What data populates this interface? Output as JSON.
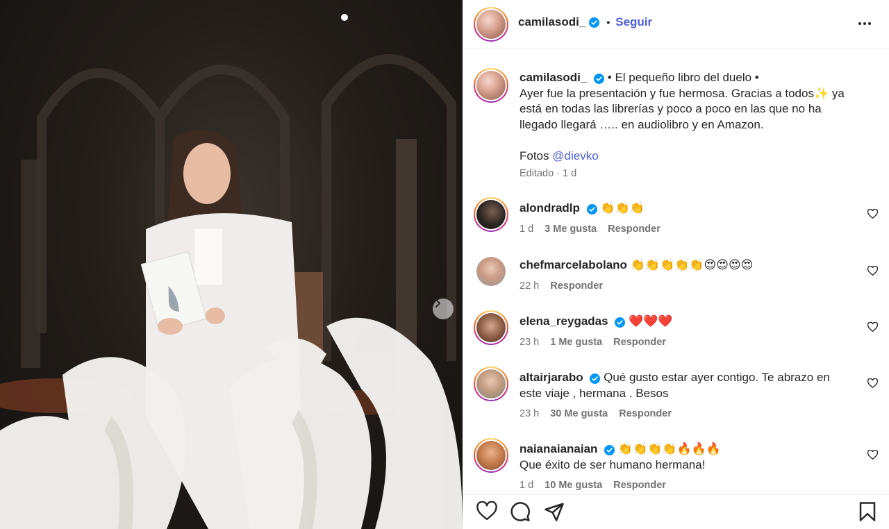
{
  "post": {
    "username": "camilasodi_",
    "follow_label": "Seguir",
    "caption_title": "• El pequeño libro del duelo •",
    "caption_body": "Ayer fue la presentación y fue hermosa. Gracias a todos✨ ya está en todas las librerías y poco a poco en las que no ha llegado llegará ….. en audiolibro y en Amazon.",
    "photos_label": "Fotos",
    "photos_handle": "@dievko",
    "edited": "Editado · 1 d"
  },
  "comments": [
    {
      "user": "alondradlp",
      "verified": true,
      "text": "👏👏👏",
      "time": "1 d",
      "likes": "3 Me gusta",
      "reply": "Responder"
    },
    {
      "user": "chefmarcelabolano",
      "verified": false,
      "text": "👏👏👏👏👏😍😍😍😍",
      "time": "22 h",
      "likes": "",
      "reply": "Responder"
    },
    {
      "user": "elena_reygadas",
      "verified": true,
      "text": "❤️❤️❤️",
      "time": "23 h",
      "likes": "1 Me gusta",
      "reply": "Responder"
    },
    {
      "user": "altairjarabo",
      "verified": true,
      "text": "Qué gusto estar ayer contigo. Te abrazo en este viaje , hermana . Besos",
      "time": "23 h",
      "likes": "30 Me gusta",
      "reply": "Responder"
    },
    {
      "user": "naianaianaian",
      "verified": true,
      "text": "👏👏👏👏🔥🔥🔥",
      "text2": "Que éxito de ser humano hermana!",
      "time": "1 d",
      "likes": "10 Me gusta",
      "reply": "Responder"
    }
  ],
  "icons": {
    "verified": "verified-badge-icon",
    "more": "more-options-icon",
    "next": "chevron-right-icon",
    "like": "heart-icon",
    "comment": "comment-bubble-icon",
    "share": "paper-plane-icon",
    "save": "bookmark-icon"
  },
  "colors": {
    "accent": "#0095f6",
    "link": "#4c5fd5",
    "verified": "#0095f6",
    "muted": "#737373"
  }
}
